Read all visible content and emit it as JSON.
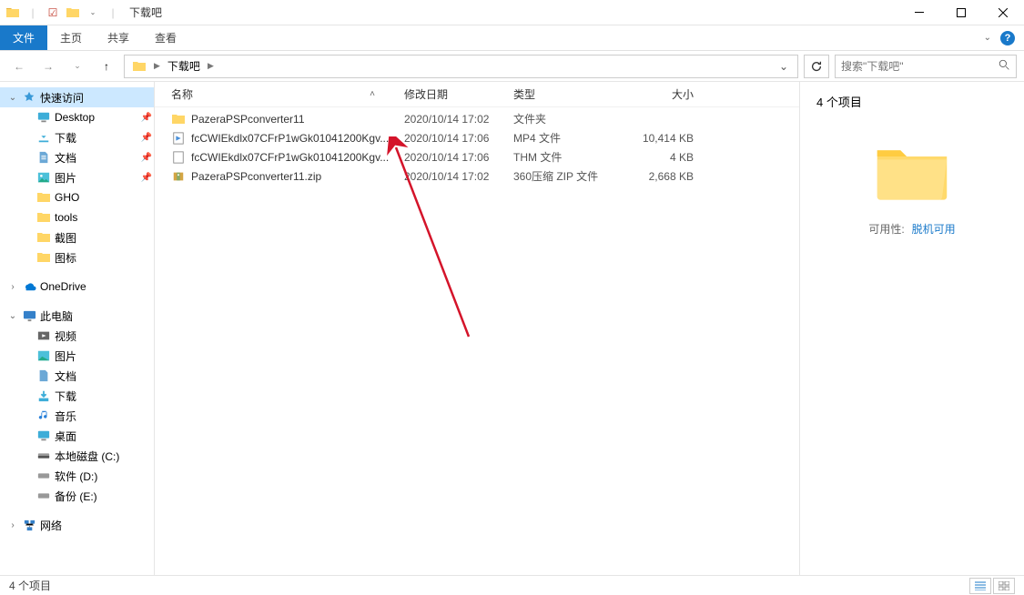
{
  "title": "下载吧",
  "ribbon": {
    "file": "文件",
    "home": "主页",
    "share": "共享",
    "view": "查看"
  },
  "breadcrumb": {
    "segments": [
      "下载吧"
    ]
  },
  "search": {
    "placeholder": "搜索\"下载吧\""
  },
  "nav": {
    "quick_access": "快速访问",
    "items_pinned": [
      {
        "label": "Desktop",
        "icon": "desktop"
      },
      {
        "label": "下载",
        "icon": "folder"
      },
      {
        "label": "文档",
        "icon": "document"
      },
      {
        "label": "图片",
        "icon": "picture"
      }
    ],
    "items_recent": [
      {
        "label": "GHO",
        "icon": "folder"
      },
      {
        "label": "tools",
        "icon": "folder"
      },
      {
        "label": "截图",
        "icon": "folder"
      },
      {
        "label": "图标",
        "icon": "folder"
      }
    ],
    "onedrive": "OneDrive",
    "thispc": "此电脑",
    "thispc_items": [
      {
        "label": "视频",
        "icon": "video"
      },
      {
        "label": "图片",
        "icon": "picture"
      },
      {
        "label": "文档",
        "icon": "document"
      },
      {
        "label": "下载",
        "icon": "download"
      },
      {
        "label": "音乐",
        "icon": "music"
      },
      {
        "label": "桌面",
        "icon": "desktop"
      },
      {
        "label": "本地磁盘 (C:)",
        "icon": "drive"
      },
      {
        "label": "软件 (D:)",
        "icon": "drive"
      },
      {
        "label": "备份 (E:)",
        "icon": "drive"
      }
    ],
    "network": "网络"
  },
  "columns": {
    "name": "名称",
    "date": "修改日期",
    "type": "类型",
    "size": "大小"
  },
  "files": [
    {
      "name": "PazeraPSPconverter11",
      "date": "2020/10/14 17:02",
      "type": "文件夹",
      "size": "",
      "icon": "folder"
    },
    {
      "name": "fcCWIEkdlx07CFrP1wGk01041200Kgv...",
      "date": "2020/10/14 17:06",
      "type": "MP4 文件",
      "size": "10,414 KB",
      "icon": "mp4"
    },
    {
      "name": "fcCWIEkdlx07CFrP1wGk01041200Kgv...",
      "date": "2020/10/14 17:06",
      "type": "THM 文件",
      "size": "4 KB",
      "icon": "file"
    },
    {
      "name": "PazeraPSPconverter11.zip",
      "date": "2020/10/14 17:02",
      "type": "360压缩 ZIP 文件",
      "size": "2,668 KB",
      "icon": "zip"
    }
  ],
  "details": {
    "title": "4 个项目",
    "avail_label": "可用性:",
    "avail_value": "脱机可用"
  },
  "status": {
    "count": "4 个项目"
  }
}
